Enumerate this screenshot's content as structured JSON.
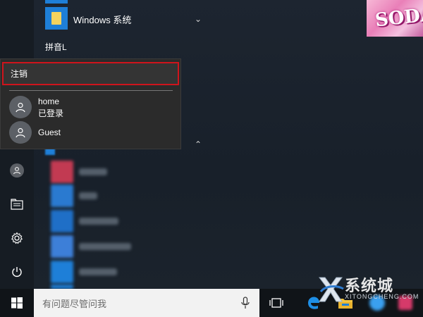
{
  "start_menu": {
    "app_list": {
      "folder_label": "Windows 系统",
      "section_label": "拼音L"
    },
    "account_popup": {
      "logout_label": "注销",
      "accounts": [
        {
          "name": "home",
          "status": "已登录"
        },
        {
          "name": "Guest",
          "status": ""
        }
      ]
    },
    "live_tile": {
      "text": "SODA"
    }
  },
  "taskbar": {
    "search_placeholder": "有问题尽管问我"
  },
  "watermark": {
    "title": "系统城",
    "subtitle": "XITONGCHENG.COM"
  },
  "colors": {
    "highlight_border": "#d0141c",
    "accent": "#1e7fd8"
  }
}
